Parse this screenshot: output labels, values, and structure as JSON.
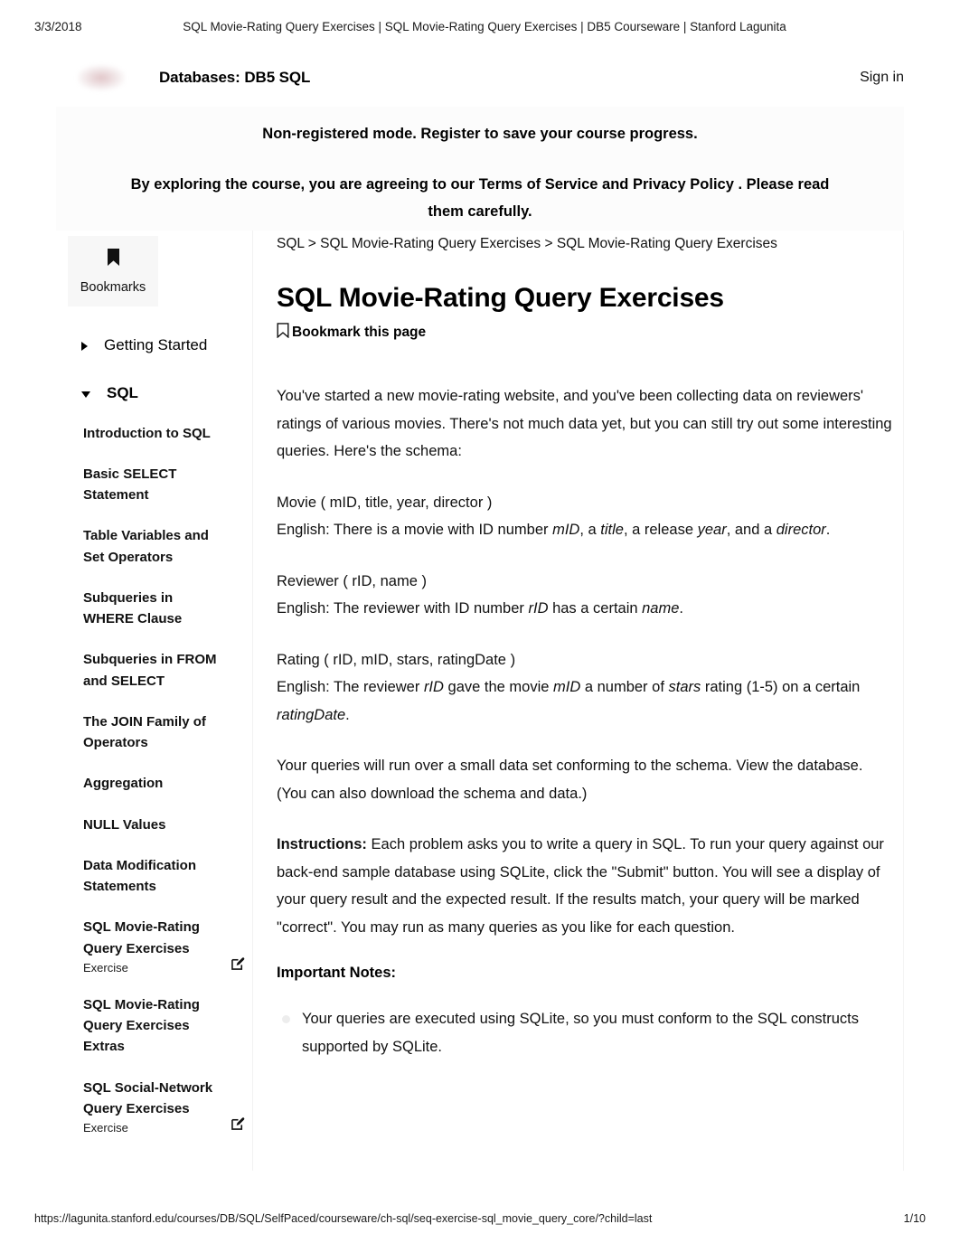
{
  "print": {
    "date": "3/3/2018",
    "doc_title": "SQL Movie-Rating Query Exercises | SQL Movie-Rating Query Exercises | DB5 Courseware | Stanford Lagunita",
    "url": "https://lagunita.stanford.edu/courses/DB/SQL/SelfPaced/courseware/ch-sql/seq-exercise-sql_movie_query_core/?child=last",
    "page_number": "1/10"
  },
  "header": {
    "logo_name": "stanford-lagunita-logo",
    "course_title": "Databases: DB5 SQL",
    "signin_label": "Sign in"
  },
  "banner": {
    "line1": "Non-registered mode.  Register to save your course progress.",
    "line2_before": "By exploring the course, you are agreeing to our ",
    "terms_label": "Terms of Service",
    "line2_mid": " and ",
    "privacy_label": "Privacy Policy",
    "line2_after": " . Please read them carefully."
  },
  "sidebar": {
    "bookmarks_tab": {
      "icon": "bookmark-filled-icon",
      "label": "Bookmarks"
    },
    "sections": [
      {
        "label": "Getting Started",
        "expanded": false,
        "icon": "chevron-right-icon"
      },
      {
        "label": "SQL",
        "expanded": true,
        "icon": "chevron-down-icon"
      }
    ],
    "items": [
      {
        "title": "Introduction to SQL",
        "sub": null,
        "edit": false
      },
      {
        "title": "Basic SELECT Statement",
        "sub": null,
        "edit": false
      },
      {
        "title": "Table Variables and Set Operators",
        "sub": null,
        "edit": false
      },
      {
        "title": "Subqueries in WHERE Clause",
        "sub": null,
        "edit": false
      },
      {
        "title": "Subqueries in FROM and SELECT",
        "sub": null,
        "edit": false
      },
      {
        "title": "The JOIN Family of Operators",
        "sub": null,
        "edit": false
      },
      {
        "title": "Aggregation",
        "sub": null,
        "edit": false
      },
      {
        "title": "NULL Values",
        "sub": null,
        "edit": false
      },
      {
        "title": "Data Modification Statements",
        "sub": null,
        "edit": false
      },
      {
        "title": "SQL Movie-Rating Query Exercises",
        "sub": "Exercise",
        "edit": true
      },
      {
        "title": "SQL Movie-Rating Query Exercises Extras",
        "sub": null,
        "edit": false
      },
      {
        "title": "SQL Social-Network Query Exercises",
        "sub": "Exercise",
        "edit": true
      }
    ]
  },
  "main": {
    "breadcrumb": "SQL > SQL Movie-Rating Query Exercises > SQL Movie-Rating Query Exercises",
    "title": "SQL Movie-Rating Query Exercises",
    "bookmark_page": {
      "icon": "bookmark-outline-icon",
      "label": "Bookmark this page"
    },
    "intro": "You've started a new movie-rating website, and you've been collecting data on reviewers' ratings of various movies. There's not much data yet, but you can still try out some interesting queries. Here's the schema:",
    "schema": [
      {
        "signature": "Movie ( mID, title, year, director )",
        "english_prefix": "English: There is a movie with ID number ",
        "terms": [
          "mID",
          "title",
          "year",
          "director"
        ],
        "connectors": [
          ", a ",
          ", a release ",
          ", and a ",
          "."
        ]
      },
      {
        "signature": "Reviewer ( rID, name )",
        "english_prefix": "English: The reviewer with ID number ",
        "terms": [
          "rID",
          "name"
        ],
        "connectors": [
          " has a certain ",
          "."
        ]
      },
      {
        "signature": "Rating ( rID, mID, stars, ratingDate )",
        "english_prefix": "English: The reviewer ",
        "terms": [
          "rID",
          "mID",
          "stars",
          "ratingDate"
        ],
        "connectors": [
          " gave the movie ",
          " a number of ",
          " rating (1-5) on a certain ",
          "."
        ]
      }
    ],
    "dataset_before": "Your queries will run over a small data set conforming to the schema. ",
    "view_db_label": "View the database.",
    "dataset_after": " (You can also ",
    "download_label": "download the schema and data",
    "dataset_end": ".)",
    "instructions_label": "Instructions:",
    "instructions_body": " Each problem asks you to write a query in SQL. To run your query against our back-end sample database using SQLite, click the \"Submit\" button. You will see a display of your query result and the expected result. If the results match, your query will be marked \"correct\". You may run as many queries as you like for each question.",
    "notes_heading": "Important Notes:",
    "notes": [
      "Your queries are executed using SQLite, so you must conform to the SQL constructs supported by SQLite."
    ]
  }
}
